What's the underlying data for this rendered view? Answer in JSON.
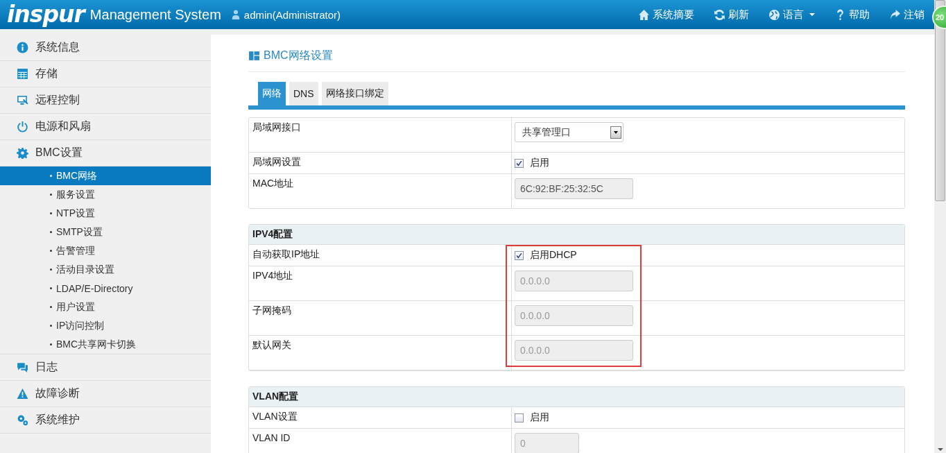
{
  "header": {
    "logo": "inspur",
    "title": "Management System",
    "user": "admin(Administrator)",
    "nav": [
      {
        "label": "系统摘要",
        "dropdown": false
      },
      {
        "label": "刷新",
        "dropdown": false
      },
      {
        "label": "语言",
        "dropdown": true
      },
      {
        "label": "帮助",
        "dropdown": false
      },
      {
        "label": "注销",
        "dropdown": false
      }
    ],
    "badge": "20"
  },
  "sidebar": {
    "items": [
      {
        "label": "系统信息"
      },
      {
        "label": "存储"
      },
      {
        "label": "远程控制"
      },
      {
        "label": "电源和风扇"
      },
      {
        "label": "BMC设置",
        "children": [
          {
            "label": "BMC网络",
            "selected": true
          },
          {
            "label": "服务设置",
            "selected": false
          },
          {
            "label": "NTP设置",
            "selected": false
          },
          {
            "label": "SMTP设置",
            "selected": false
          },
          {
            "label": "告警管理",
            "selected": false
          },
          {
            "label": "活动目录设置",
            "selected": false
          },
          {
            "label": "LDAP/E-Directory",
            "selected": false
          },
          {
            "label": "用户设置",
            "selected": false
          },
          {
            "label": "IP访问控制",
            "selected": false
          },
          {
            "label": "BMC共享网卡切换",
            "selected": false
          }
        ]
      },
      {
        "label": "日志"
      },
      {
        "label": "故障诊断"
      },
      {
        "label": "系统维护"
      }
    ]
  },
  "page_title": "BMC网络设置",
  "tabs": [
    {
      "label": "网络",
      "selected": true
    },
    {
      "label": "DNS",
      "selected": false
    },
    {
      "label": "网络接口绑定",
      "selected": false
    }
  ],
  "sections": [
    {
      "highlighted": false,
      "rows": [
        {
          "label": "局域网接口",
          "kind": "select",
          "value": "共享管理口"
        },
        {
          "label": "局域网设置",
          "kind": "checkbox",
          "checked": true,
          "text": "启用"
        },
        {
          "label": "MAC地址",
          "kind": "field",
          "value": "6C:92:BF:25:32:5C",
          "disabled": false
        }
      ]
    },
    {
      "title": "IPV4配置",
      "highlighted": true,
      "rows": [
        {
          "label": "自动获取IP地址",
          "kind": "checkbox",
          "checked": true,
          "text": "启用DHCP"
        },
        {
          "label": "IPV4地址",
          "kind": "field",
          "value": "0.0.0.0",
          "disabled": true
        },
        {
          "label": "子网掩码",
          "kind": "field",
          "value": "0.0.0.0",
          "disabled": true
        },
        {
          "label": "默认网关",
          "kind": "field",
          "value": "0.0.0.0",
          "disabled": true
        }
      ]
    },
    {
      "title": "VLAN配置",
      "highlighted": false,
      "rows": [
        {
          "label": "VLAN设置",
          "kind": "checkbox",
          "checked": false,
          "text": "启用"
        },
        {
          "label": "VLAN ID",
          "kind": "shortfield",
          "value": "0",
          "disabled": true
        }
      ]
    }
  ]
}
